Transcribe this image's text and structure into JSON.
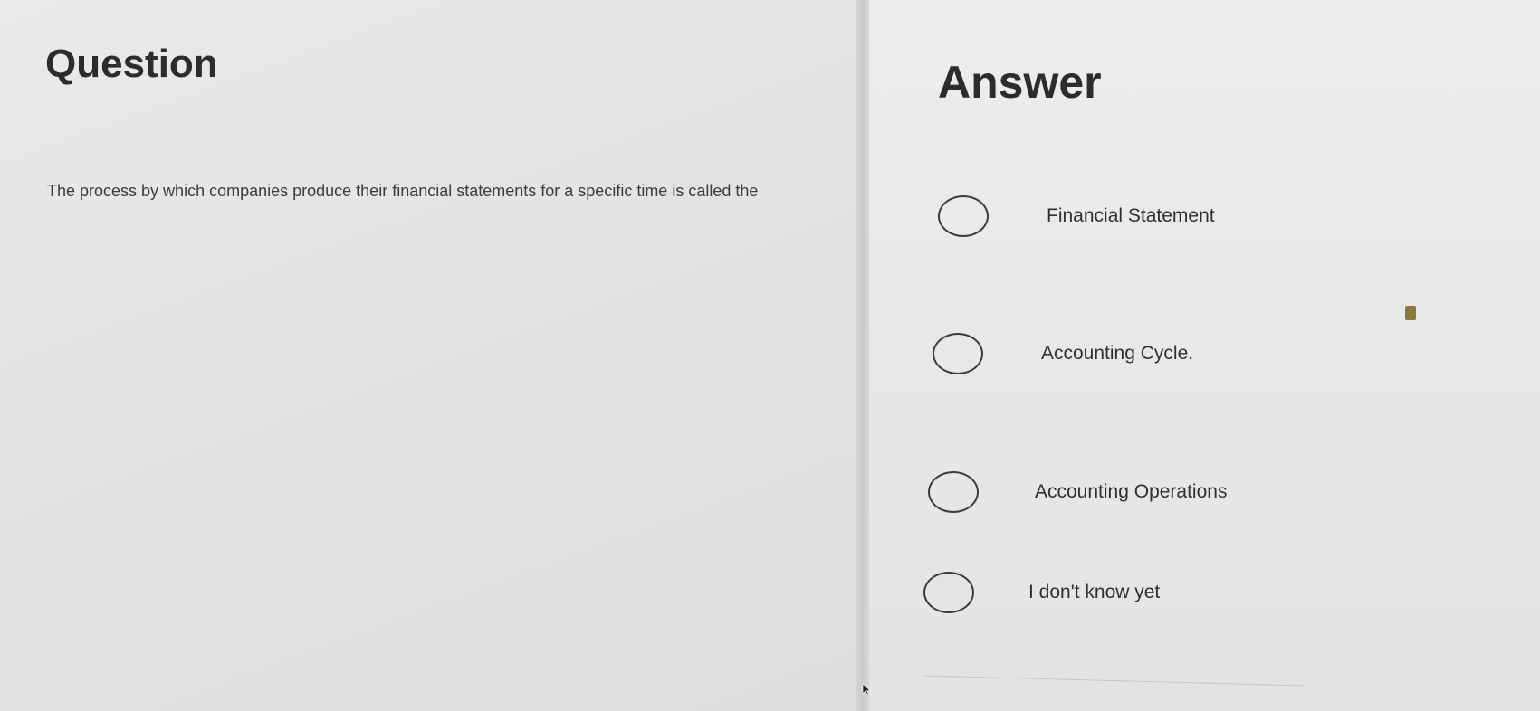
{
  "question": {
    "title": "Question",
    "text": "The process by which companies produce their financial statements for a specific time is called the"
  },
  "answer": {
    "title": "Answer",
    "options": [
      {
        "label": "Financial Statement",
        "selected": false
      },
      {
        "label": "Accounting Cycle.",
        "selected": false
      },
      {
        "label": "Accounting Operations",
        "selected": false
      },
      {
        "label": "I don't know yet",
        "selected": false
      }
    ]
  },
  "icons": {
    "radio": "radio-circle-icon",
    "cursor": "mouse-cursor-icon"
  }
}
